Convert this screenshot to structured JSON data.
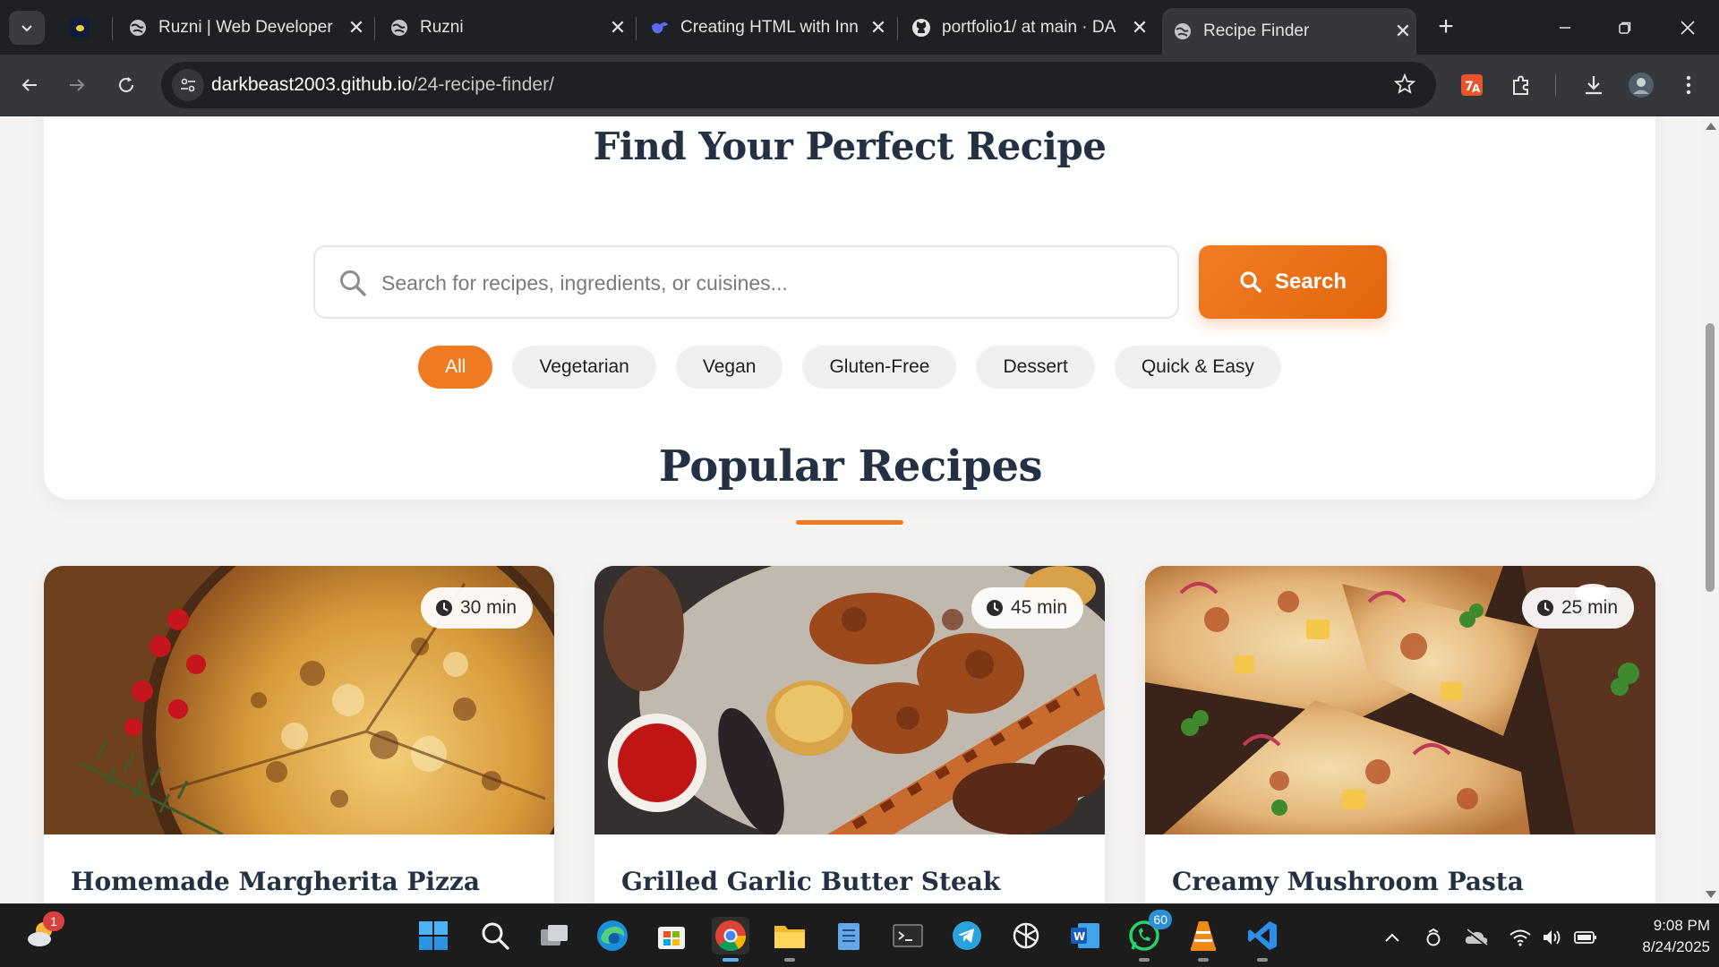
{
  "browser": {
    "tabs": [
      {
        "title": "",
        "icon": "app-favicon"
      },
      {
        "title": "Ruzni | Web Developer",
        "icon": "globe-icon"
      },
      {
        "title": "Ruzni",
        "icon": "globe-icon"
      },
      {
        "title": "Creating HTML with Inn",
        "icon": "deepseek-icon"
      },
      {
        "title": "portfolio1/ at main · DA",
        "icon": "github-icon"
      },
      {
        "title": "Recipe Finder",
        "icon": "globe-icon",
        "active": true
      }
    ],
    "url_host": "darkbeast2003.github.io",
    "url_path": "/24-recipe-finder/"
  },
  "hero": {
    "title": "Find Your Perfect Recipe",
    "search_placeholder": "Search for recipes, ingredients, or cuisines...",
    "search_value": "",
    "search_button": "Search",
    "filters": [
      "All",
      "Vegetarian",
      "Vegan",
      "Gluten-Free",
      "Dessert",
      "Quick & Easy"
    ],
    "active_filter": "All"
  },
  "popular": {
    "title": "Popular Recipes",
    "recipes": [
      {
        "title": "Homemade Margherita Pizza",
        "time": "30 min"
      },
      {
        "title": "Grilled Garlic Butter Steak",
        "time": "45 min"
      },
      {
        "title": "Creamy Mushroom Pasta",
        "time": "25 min"
      }
    ]
  },
  "colors": {
    "accent": "#ee7a22",
    "heading": "#233142",
    "page_bg": "#f6f4f3"
  },
  "taskbar": {
    "apps": [
      "windows-start-icon",
      "search-icon",
      "task-view-icon",
      "edge-icon",
      "store-icon",
      "chrome-icon",
      "file-explorer-icon",
      "notepad-icon",
      "terminal-icon",
      "telegram-icon",
      "chatgpt-icon",
      "word-icon",
      "whatsapp-icon",
      "vlc-icon",
      "vscode-icon"
    ],
    "weather_badge": "1",
    "whatsapp_badge": "60",
    "time": "9:08 PM",
    "date": "8/24/2025"
  }
}
